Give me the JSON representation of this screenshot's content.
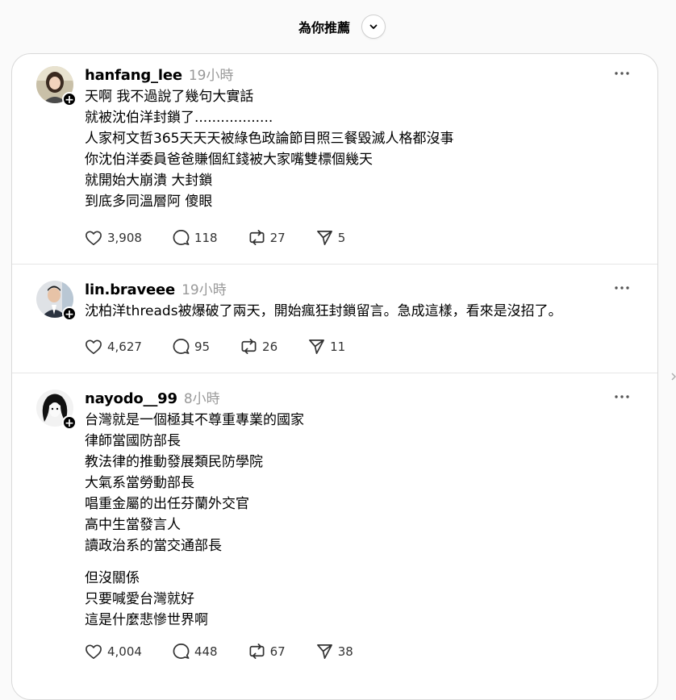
{
  "header": {
    "title": "為你推薦",
    "dropdown_icon": "chevron-down-icon"
  },
  "posts": [
    {
      "username": "hanfang_lee",
      "time": "19小時",
      "lines": [
        "天啊 我不過說了幾句大實話",
        "就被沈伯洋封鎖了..................",
        "人家柯文哲365天天天被綠色政論節目照三餐毀滅人格都沒事",
        "你沈伯洋委員爸爸賺個紅錢被大家嘴雙標個幾天",
        "就開始大崩潰 大封鎖",
        "到底多同溫層阿 傻眼"
      ],
      "likes": "3,908",
      "replies": "118",
      "reposts": "27",
      "shares": "5"
    },
    {
      "username": "lin.braveee",
      "time": "19小時",
      "lines": [
        "沈柏洋threads被爆破了兩天，開始瘋狂封鎖留言。急成這樣，看來是沒招了。"
      ],
      "likes": "4,627",
      "replies": "95",
      "reposts": "26",
      "shares": "11"
    },
    {
      "username": "nayodo__99",
      "time": "8小時",
      "lines": [
        "台灣就是一個極其不尊重專業的國家",
        "律師當國防部長",
        "教法律的推動發展類民防學院",
        "大氣系當勞動部長",
        "唱重金屬的出任芬蘭外交官",
        "高中生當發言人",
        "讀政治系的當交通部長"
      ],
      "lines2": [
        "但沒關係",
        "只要喊愛台灣就好",
        "這是什麼悲慘世界啊"
      ],
      "likes": "4,004",
      "replies": "448",
      "reposts": "67",
      "shares": "38"
    }
  ],
  "icons": {
    "like": "heart-icon",
    "reply": "comment-icon",
    "repost": "repost-icon",
    "share": "send-icon",
    "more": "more-options-icon",
    "follow": "plus-icon"
  },
  "follow_symbol": "+"
}
